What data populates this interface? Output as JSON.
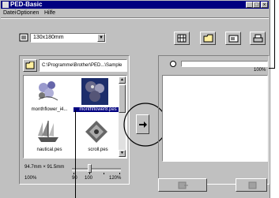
{
  "window": {
    "title": "PED-Basic"
  },
  "menu": {
    "items": [
      "Datei",
      "Optionen",
      "Hilfe"
    ]
  },
  "toolbar": {
    "hoop_size": "130x180mm"
  },
  "browser": {
    "path": "C:\\Programme\\Brother\\PED...\\Sample",
    "files": [
      {
        "name": "monthflower_i4...",
        "selected": false
      },
      {
        "name": "monthflower8.pes",
        "selected": true
      },
      {
        "name": "nautical.pes",
        "selected": false
      },
      {
        "name": "scroll.pes",
        "selected": false
      }
    ],
    "dimensions": "94.7mm × 91.5mm",
    "zoom_value": "100%",
    "zoom_ticks": [
      "90",
      "100",
      "120%"
    ]
  },
  "target": {
    "progress_label": "100%",
    "progress_fraction": 1.0
  },
  "colors": {
    "titlebar": "#000080",
    "selection": "#000080",
    "face": "#c0c0c0"
  }
}
